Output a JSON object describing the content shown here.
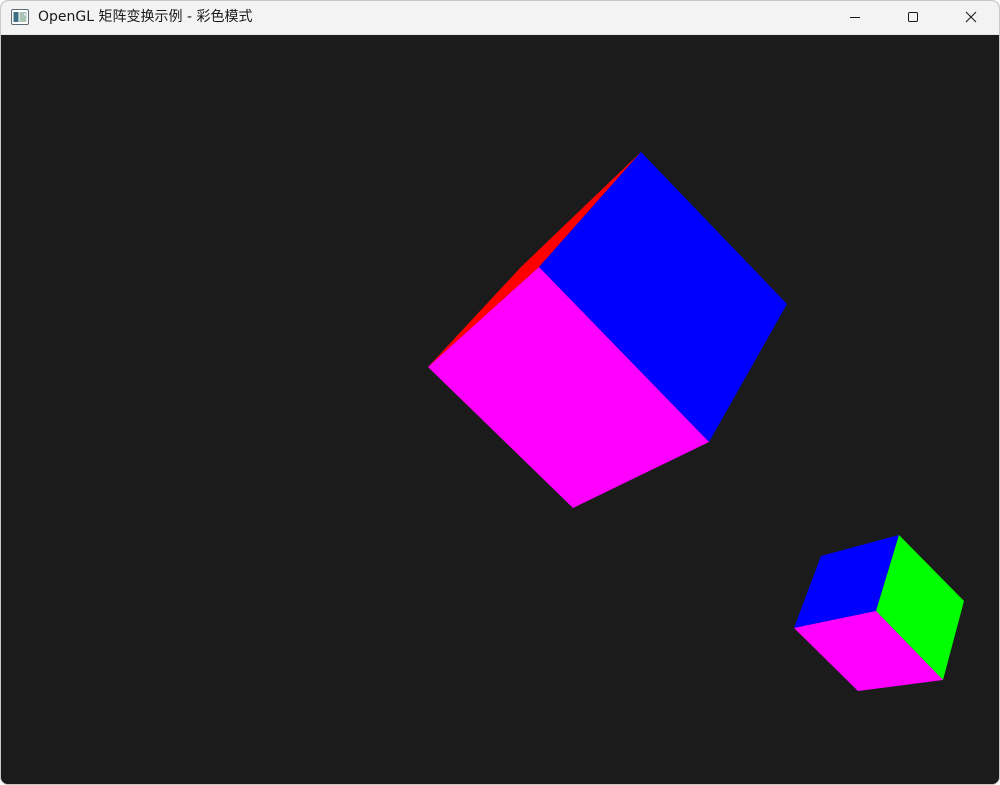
{
  "window": {
    "title": "OpenGL 矩阵变换示例 - 彩色模式",
    "background_color": "#1b1b1b",
    "titlebar_color": "#f3f3f3",
    "icons": {
      "app": "opengl-app-icon",
      "minimize": "minimize-icon",
      "maximize": "maximize-icon",
      "close": "close-icon"
    }
  },
  "scene": {
    "cube_face_colors": {
      "red": "#ff0000",
      "green": "#00ff00",
      "blue": "#0000ff",
      "magenta": "#ff00ff"
    }
  }
}
